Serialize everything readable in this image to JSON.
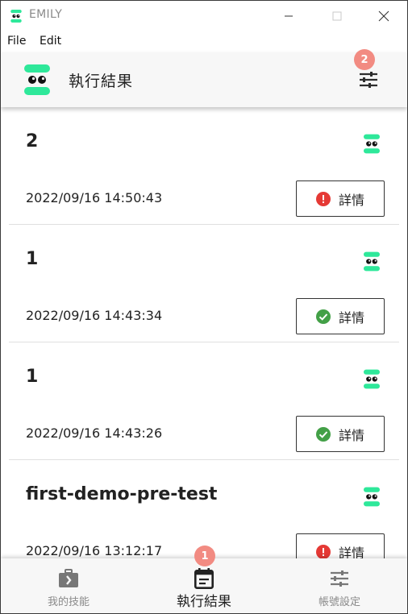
{
  "window": {
    "title": "EMILY"
  },
  "menu": {
    "file": "File",
    "edit": "Edit"
  },
  "header": {
    "title": "執行結果"
  },
  "badges": {
    "filter": "2",
    "nav": "1"
  },
  "records": [
    {
      "name": "2",
      "time": "2022/09/16 14:50:43",
      "status": "error",
      "button": "詳情"
    },
    {
      "name": "1",
      "time": "2022/09/16 14:43:34",
      "status": "success",
      "button": "詳情"
    },
    {
      "name": "1",
      "time": "2022/09/16 14:43:26",
      "status": "success",
      "button": "詳情"
    },
    {
      "name": "first-demo-pre-test",
      "time": "2022/09/16 13:12:17",
      "status": "error",
      "button": "詳情"
    }
  ],
  "nav": {
    "skills": "我的技能",
    "results": "執行結果",
    "account": "帳號設定"
  },
  "colors": {
    "brand": "#2ee89a",
    "error": "#e53935",
    "success": "#43a047",
    "badge": "#f28b82",
    "icon": "#2d2d2d"
  },
  "icons": {
    "logo": "robot-eyes-icon",
    "filter": "sliders-icon",
    "error": "error-circle-icon",
    "success": "check-circle-icon",
    "skills": "briefcase-arrow-icon",
    "results": "calendar-list-icon",
    "account": "sliders-icon"
  }
}
